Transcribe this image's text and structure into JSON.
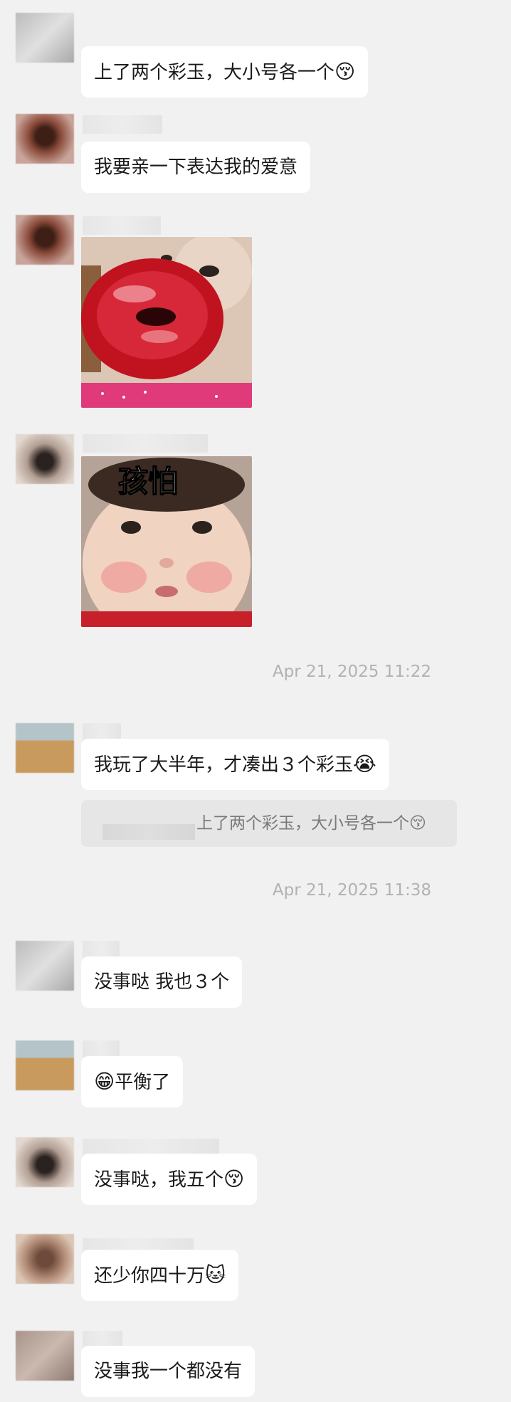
{
  "messages": [
    {
      "text": "上了两个彩玉，大小号各一个",
      "emoji": "😚"
    },
    {
      "text": "我要亲一下表达我的爱意",
      "emoji": ""
    },
    {
      "sticker_caption": "孩怕"
    },
    {
      "text": "我玩了大半年，才凑出３个彩玉",
      "emoji": "😭",
      "quote": {
        "text": "上了两个彩玉，大小号各一个",
        "emoji": "😚"
      }
    },
    {
      "text": "没事哒 我也３个",
      "emoji": ""
    },
    {
      "text": "平衡了",
      "emoji": "😁"
    },
    {
      "text": "没事哒，我五个",
      "emoji": "😚"
    },
    {
      "text": "还少你四十万",
      "emoji": "🐱"
    },
    {
      "text": "没事我一个都没有",
      "emoji": ""
    }
  ],
  "timestamps": [
    "Apr 21, 2025 11:22",
    "Apr 21, 2025 11:38"
  ]
}
